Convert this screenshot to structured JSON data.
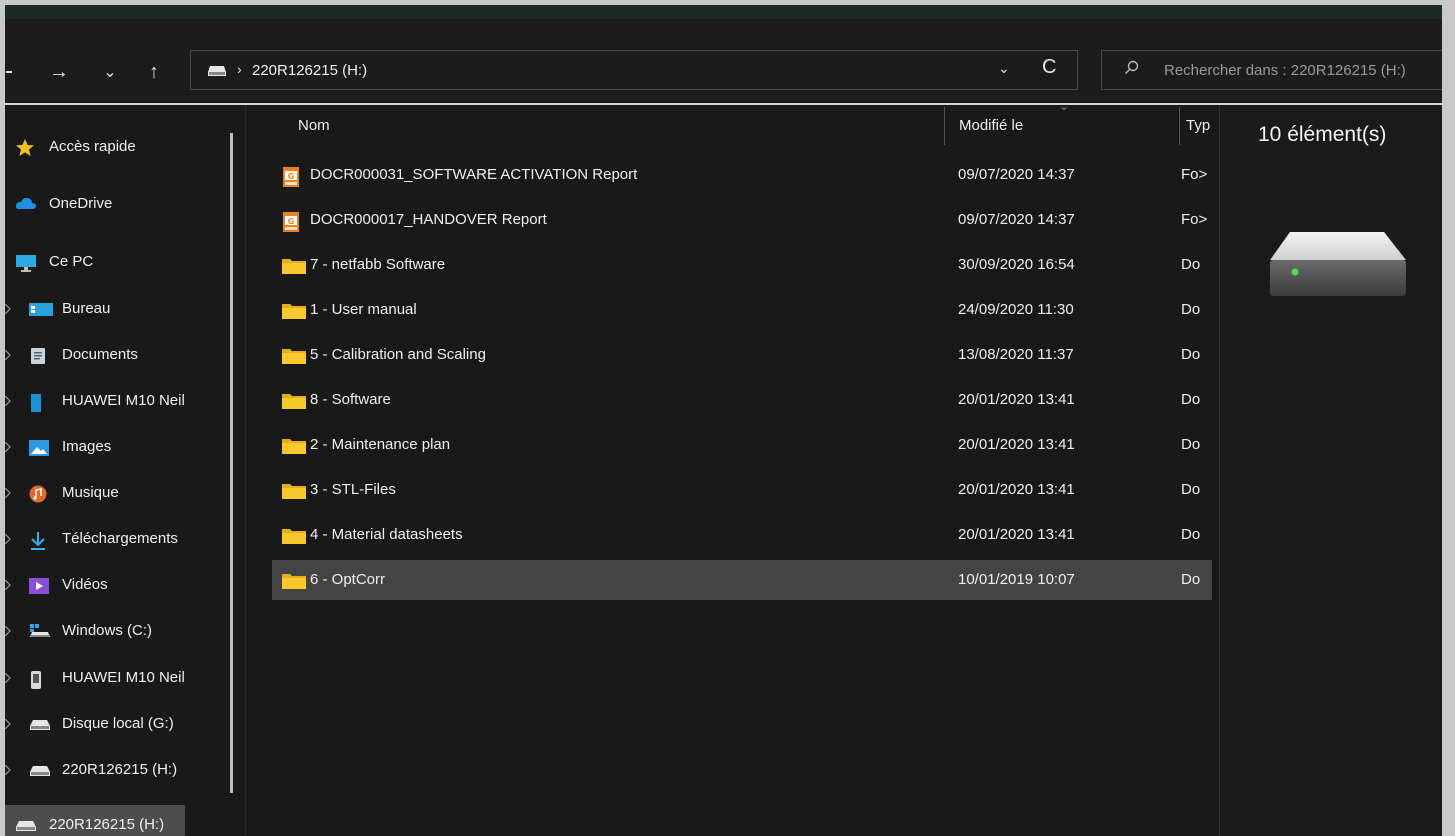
{
  "toolbar": {
    "forward_icon": "→",
    "recent_icon": "⌄",
    "up_icon": "↑",
    "address_separator": "›",
    "address_path": "220R126215 (H:)",
    "address_dropdown_icon": "⌄",
    "refresh_icon": "C",
    "search_placeholder": "Rechercher dans : 220R126215 (H:)"
  },
  "sidebar": {
    "items": [
      {
        "label": "Accès rapide",
        "icon": "star-icon"
      },
      {
        "label": "OneDrive",
        "icon": "cloud-icon"
      },
      {
        "label": "Ce PC",
        "icon": "monitor-icon"
      },
      {
        "label": "Bureau",
        "icon": "desktop-icon"
      },
      {
        "label": "Documents",
        "icon": "document-icon"
      },
      {
        "label": "HUAWEI M10 Neil",
        "icon": "tablet-icon"
      },
      {
        "label": "Images",
        "icon": "image-icon"
      },
      {
        "label": "Musique",
        "icon": "music-icon"
      },
      {
        "label": "Téléchargements",
        "icon": "download-icon"
      },
      {
        "label": "Vidéos",
        "icon": "video-icon"
      },
      {
        "label": "Windows (C:)",
        "icon": "windows-drive-icon"
      },
      {
        "label": "HUAWEI M10 Neil",
        "icon": "phone-icon"
      },
      {
        "label": "Disque local (G:)",
        "icon": "drive-icon"
      },
      {
        "label": "220R126215 (H:)",
        "icon": "drive-icon"
      },
      {
        "label": "220R126215 (H:)",
        "icon": "drive-icon"
      }
    ]
  },
  "filelist": {
    "headers": {
      "name": "Nom",
      "modified": "Modifié le",
      "type": "Typ"
    },
    "sort_indicator": "⌄",
    "rows": [
      {
        "name": "DOCR000031_SOFTWARE ACTIVATION Report",
        "date": "09/07/2020 14:37",
        "type": "Fo>",
        "kind": "pdf"
      },
      {
        "name": "DOCR000017_HANDOVER Report",
        "date": "09/07/2020 14:37",
        "type": "Fo>",
        "kind": "pdf"
      },
      {
        "name": "7 - netfabb Software",
        "date": "30/09/2020 16:54",
        "type": "Do",
        "kind": "folder"
      },
      {
        "name": "1 - User manual",
        "date": "24/09/2020 11:30",
        "type": "Do",
        "kind": "folder"
      },
      {
        "name": "5 - Calibration and Scaling",
        "date": "13/08/2020 11:37",
        "type": "Do",
        "kind": "folder"
      },
      {
        "name": "8 - Software",
        "date": "20/01/2020 13:41",
        "type": "Do",
        "kind": "folder"
      },
      {
        "name": "2 - Maintenance plan",
        "date": "20/01/2020 13:41",
        "type": "Do",
        "kind": "folder"
      },
      {
        "name": "3 - STL-Files",
        "date": "20/01/2020 13:41",
        "type": "Do",
        "kind": "folder"
      },
      {
        "name": "4 - Material datasheets",
        "date": "20/01/2020 13:41",
        "type": "Do",
        "kind": "folder"
      },
      {
        "name": "6 - OptCorr",
        "date": "10/01/2019 10:07",
        "type": "Do",
        "kind": "folder"
      }
    ]
  },
  "preview": {
    "count_label": "10 élément(s)",
    "drive_icon": "hard-drive-icon"
  },
  "colors": {
    "window_bg": "#191919",
    "selected_row": "#444444",
    "folder": "#f3c02c",
    "pdf": "#e8821e"
  }
}
